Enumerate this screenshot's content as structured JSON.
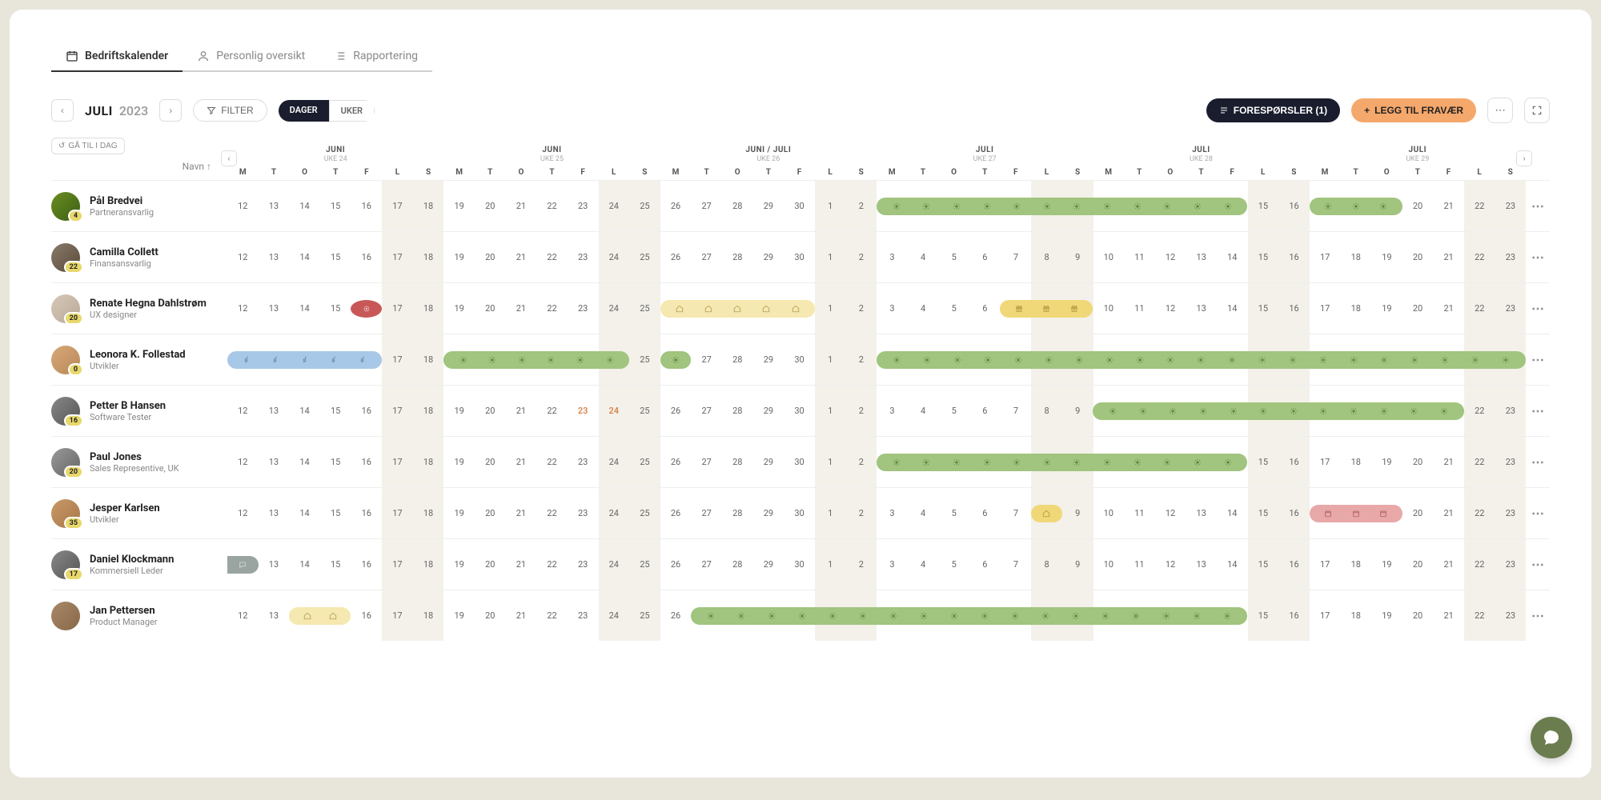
{
  "tabs": [
    {
      "label": "Bedriftskalender",
      "active": true,
      "icon": "calendar"
    },
    {
      "label": "Personlig oversikt",
      "active": false,
      "icon": "person"
    },
    {
      "label": "Rapportering",
      "active": false,
      "icon": "list"
    }
  ],
  "toolbar": {
    "month": "JULI",
    "year": "2023",
    "filter": "FILTER",
    "toggle": {
      "days": "DAGER",
      "weeks": "UKER"
    },
    "requests": "FORESPØRSLER (1)",
    "add": "LEGG TIL FRAVÆR"
  },
  "today_btn": "GÅ TIL I DAG",
  "sort_label": "Navn ↑",
  "dow": [
    "M",
    "T",
    "O",
    "T",
    "F",
    "L",
    "S"
  ],
  "weeks": [
    {
      "title": "JUNI",
      "sub": "UKE 24",
      "start": 12
    },
    {
      "title": "JUNI",
      "sub": "UKE 25",
      "start": 19
    },
    {
      "title": "JUNI / JULI",
      "sub": "UKE 26",
      "start": 26,
      "wrap": 30
    },
    {
      "title": "JULI",
      "sub": "UKE 27",
      "start": 3
    },
    {
      "title": "JULI",
      "sub": "UKE 28",
      "start": 10
    },
    {
      "title": "JULI",
      "sub": "UKE 29",
      "start": 17
    }
  ],
  "people": [
    {
      "name": "Pål Bredvei",
      "role": "Partneransvarlig",
      "badge": 4,
      "av": "av1",
      "bars": [
        {
          "type": "green",
          "start": 21,
          "len": 12,
          "icons": "dot"
        },
        {
          "type": "green",
          "start": 35,
          "len": 3,
          "icons": "dot"
        }
      ]
    },
    {
      "name": "Camilla Collett",
      "role": "Finansansvarlig",
      "badge": 22,
      "av": "av2",
      "bars": []
    },
    {
      "name": "Renate Hegna Dahlstrøm",
      "role": "UX designer",
      "badge": 20,
      "av": "av3",
      "bars": [
        {
          "type": "circle",
          "start": 4,
          "len": 1,
          "icons": "target"
        },
        {
          "type": "ylite",
          "start": 14,
          "len": 5,
          "icons": "home"
        },
        {
          "type": "yellow",
          "start": 25,
          "len": 3,
          "icons": "gift"
        }
      ]
    },
    {
      "name": "Leonora K. Follestad",
      "role": "Utvikler",
      "badge": 0,
      "av": "av4",
      "bars": [
        {
          "type": "blue",
          "start": 0,
          "len": 5,
          "icons": "run"
        },
        {
          "type": "green",
          "start": 7,
          "len": 6,
          "icons": "dot"
        },
        {
          "type": "green",
          "start": 14,
          "len": 1,
          "icons": "dot"
        },
        {
          "type": "green",
          "start": 21,
          "len": 21,
          "icons": "dot"
        }
      ]
    },
    {
      "name": "Petter B Hansen",
      "role": "Software Tester",
      "badge": 16,
      "av": "av5",
      "bars": [
        {
          "type": "green",
          "start": 28,
          "len": 12,
          "icons": "dot"
        }
      ],
      "holidays": [
        11,
        12
      ]
    },
    {
      "name": "Paul Jones",
      "role": "Sales Representive, UK",
      "badge": 20,
      "av": "av6",
      "bars": [
        {
          "type": "green",
          "start": 21,
          "len": 12,
          "icons": "dot"
        }
      ]
    },
    {
      "name": "Jesper Karlsen",
      "role": "Utvikler",
      "badge": 35,
      "av": "av7",
      "bars": [
        {
          "type": "yellow",
          "start": 26,
          "len": 1,
          "icons": "home"
        },
        {
          "type": "red",
          "start": 35,
          "len": 3,
          "icons": "cal"
        }
      ]
    },
    {
      "name": "Daniel Klockmann",
      "role": "Kommersiell Leder",
      "badge": 17,
      "av": "av8",
      "bars": [
        {
          "type": "grey",
          "start": 0,
          "len": 1,
          "icons": "chat"
        }
      ]
    },
    {
      "name": "Jan Pettersen",
      "role": "Product Manager",
      "badge": "",
      "av": "av9",
      "bars": [
        {
          "type": "ylite",
          "start": 2,
          "len": 2,
          "icons": "home"
        },
        {
          "type": "green",
          "start": 15,
          "len": 18,
          "icons": "dot"
        }
      ]
    }
  ]
}
